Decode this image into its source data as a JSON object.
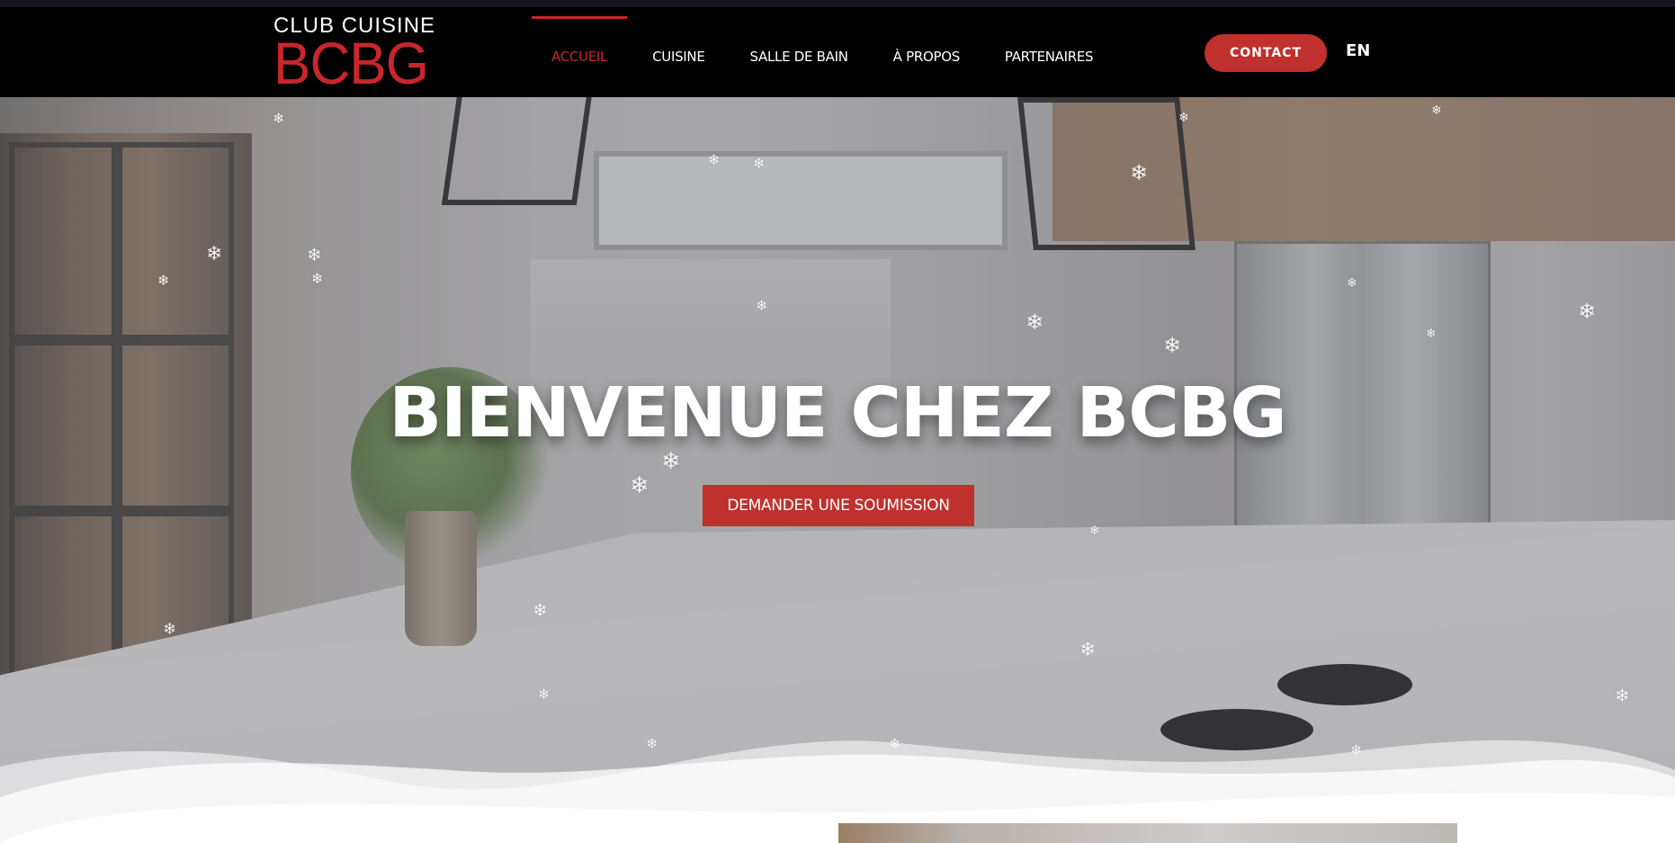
{
  "header": {
    "logo_line1": "CLUB CUISINE",
    "logo_line2": "BCBG",
    "nav_items": [
      {
        "label": "ACCUEIL",
        "active": true
      },
      {
        "label": "CUISINE",
        "active": false
      },
      {
        "label": "SALLE DE BAIN",
        "active": false
      },
      {
        "label": "À PROPOS",
        "active": false
      },
      {
        "label": "PARTENAIRES",
        "active": false
      }
    ],
    "contact_label": "CONTACT",
    "language_label": "EN"
  },
  "hero": {
    "title": "BIENVENUE CHEZ BCBG",
    "cta_label": "DEMANDER UNE SOUMISSION",
    "snowflake_icon": "snowflake-icon"
  },
  "colors": {
    "accent_red": "#c0312e",
    "logo_red": "#c8262b",
    "header_bg": "#000000"
  }
}
